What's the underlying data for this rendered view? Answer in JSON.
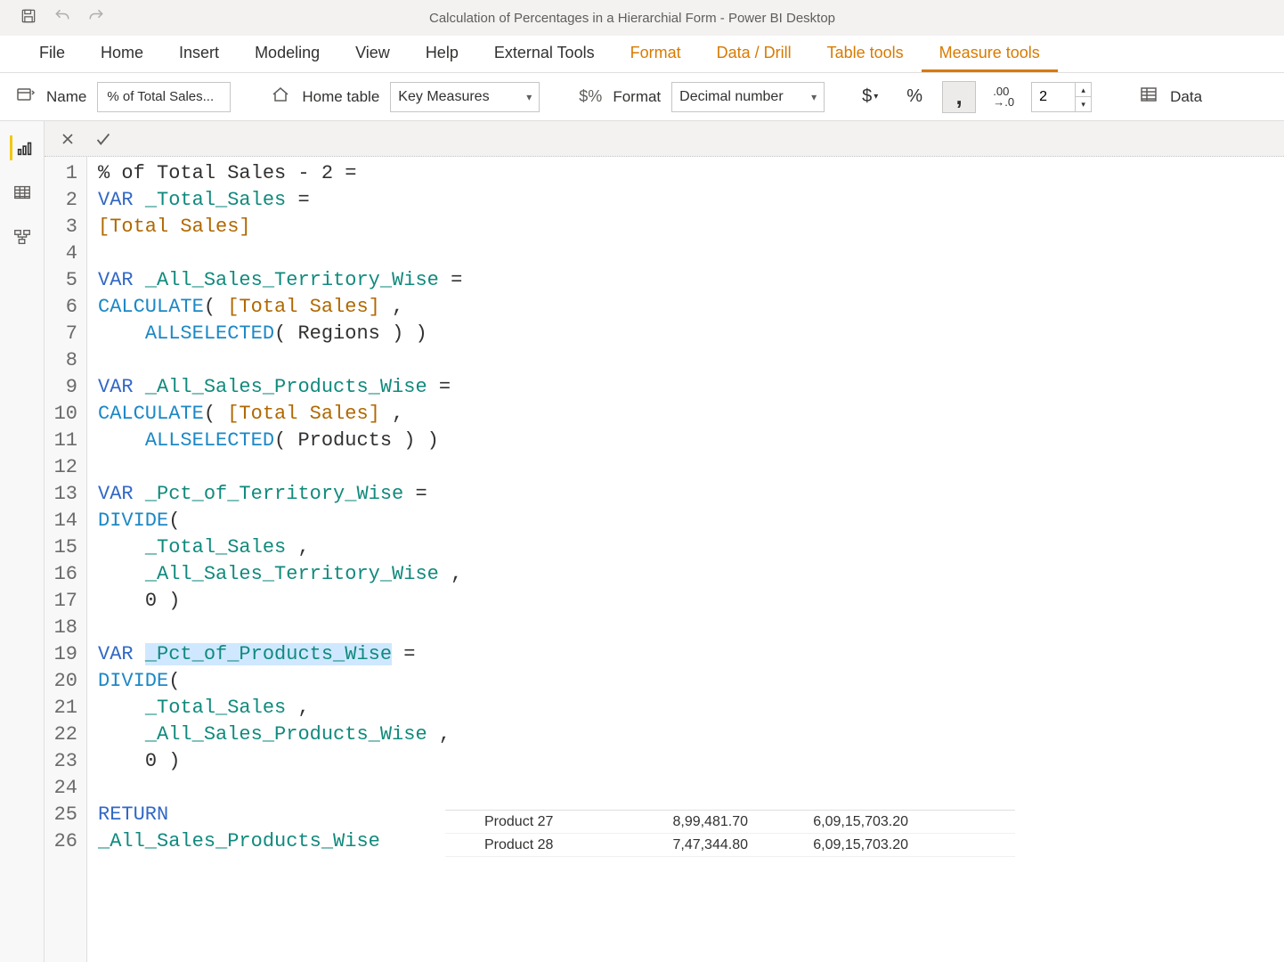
{
  "titlebar": {
    "title": "Calculation of Percentages in a Hierarchial Form - Power BI Desktop"
  },
  "tabs": {
    "file": "File",
    "home": "Home",
    "insert": "Insert",
    "modeling": "Modeling",
    "view": "View",
    "help": "Help",
    "external": "External Tools",
    "format": "Format",
    "datadrill": "Data / Drill",
    "tabletools": "Table tools",
    "measuretools": "Measure tools"
  },
  "ribbon": {
    "name_label": "Name",
    "name_value": "% of Total Sales...",
    "hometable_label": "Home table",
    "hometable_value": "Key Measures",
    "format_label": "Format",
    "format_value": "Decimal number",
    "decimals_value": "2",
    "data_label": "Data"
  },
  "code": {
    "lines": [
      [
        {
          "t": "% of Total Sales - 2 ",
          "c": "pn"
        },
        {
          "t": "=",
          "c": "pn"
        }
      ],
      [
        {
          "t": "VAR ",
          "c": "kw"
        },
        {
          "t": "_Total_Sales",
          "c": "id"
        },
        {
          "t": " =",
          "c": "pn"
        }
      ],
      [
        {
          "t": "[Total Sales]",
          "c": "meas"
        }
      ],
      [],
      [
        {
          "t": "VAR ",
          "c": "kw"
        },
        {
          "t": "_All_Sales_Territory_Wise",
          "c": "id"
        },
        {
          "t": " =",
          "c": "pn"
        }
      ],
      [
        {
          "t": "CALCULATE",
          "c": "fn"
        },
        {
          "t": "( ",
          "c": "pn"
        },
        {
          "t": "[Total Sales]",
          "c": "meas"
        },
        {
          "t": " ,",
          "c": "pn"
        }
      ],
      [
        {
          "t": "    ",
          "c": "pn"
        },
        {
          "t": "ALLSELECTED",
          "c": "fn"
        },
        {
          "t": "( Regions ) )",
          "c": "pn"
        }
      ],
      [],
      [
        {
          "t": "VAR ",
          "c": "kw"
        },
        {
          "t": "_All_Sales_Products_Wise",
          "c": "id"
        },
        {
          "t": " =",
          "c": "pn"
        }
      ],
      [
        {
          "t": "CALCULATE",
          "c": "fn"
        },
        {
          "t": "( ",
          "c": "pn"
        },
        {
          "t": "[Total Sales]",
          "c": "meas"
        },
        {
          "t": " ,",
          "c": "pn"
        }
      ],
      [
        {
          "t": "    ",
          "c": "pn"
        },
        {
          "t": "ALLSELECTED",
          "c": "fn"
        },
        {
          "t": "( Products ) )",
          "c": "pn"
        }
      ],
      [],
      [
        {
          "t": "VAR ",
          "c": "kw"
        },
        {
          "t": "_Pct_of_Territory_Wise",
          "c": "id"
        },
        {
          "t": " =",
          "c": "pn"
        }
      ],
      [
        {
          "t": "DIVIDE",
          "c": "fn"
        },
        {
          "t": "(",
          "c": "pn"
        }
      ],
      [
        {
          "t": "    ",
          "c": "pn"
        },
        {
          "t": "_Total_Sales",
          "c": "id"
        },
        {
          "t": " ,",
          "c": "pn"
        }
      ],
      [
        {
          "t": "    ",
          "c": "pn"
        },
        {
          "t": "_All_Sales_Territory_Wise",
          "c": "id"
        },
        {
          "t": " ,",
          "c": "pn"
        }
      ],
      [
        {
          "t": "    ",
          "c": "pn"
        },
        {
          "t": "0",
          "c": "num"
        },
        {
          "t": " )",
          "c": "pn"
        }
      ],
      [],
      [
        {
          "t": "VAR ",
          "c": "kw"
        },
        {
          "t": "_Pct_of_Products_Wise",
          "c": "id hl"
        },
        {
          "t": " =",
          "c": "pn"
        }
      ],
      [
        {
          "t": "DIVIDE",
          "c": "fn"
        },
        {
          "t": "(",
          "c": "pn"
        }
      ],
      [
        {
          "t": "    ",
          "c": "pn"
        },
        {
          "t": "_Total_Sales",
          "c": "id"
        },
        {
          "t": " ,",
          "c": "pn"
        }
      ],
      [
        {
          "t": "    ",
          "c": "pn"
        },
        {
          "t": "_All_Sales_Products_Wise",
          "c": "id"
        },
        {
          "t": " ,",
          "c": "pn"
        }
      ],
      [
        {
          "t": "    ",
          "c": "pn"
        },
        {
          "t": "0",
          "c": "num"
        },
        {
          "t": " )",
          "c": "pn"
        }
      ],
      [],
      [
        {
          "t": "RETURN",
          "c": "kw"
        }
      ],
      [
        {
          "t": "_All_Sales_Products_Wise",
          "c": "id"
        }
      ]
    ]
  },
  "datapeek": {
    "rows": [
      {
        "c1": "Product 27",
        "c2": "8,99,481.70",
        "c3": "6,09,15,703.20"
      },
      {
        "c1": "Product 28",
        "c2": "7,47,344.80",
        "c3": "6,09,15,703.20"
      }
    ]
  }
}
